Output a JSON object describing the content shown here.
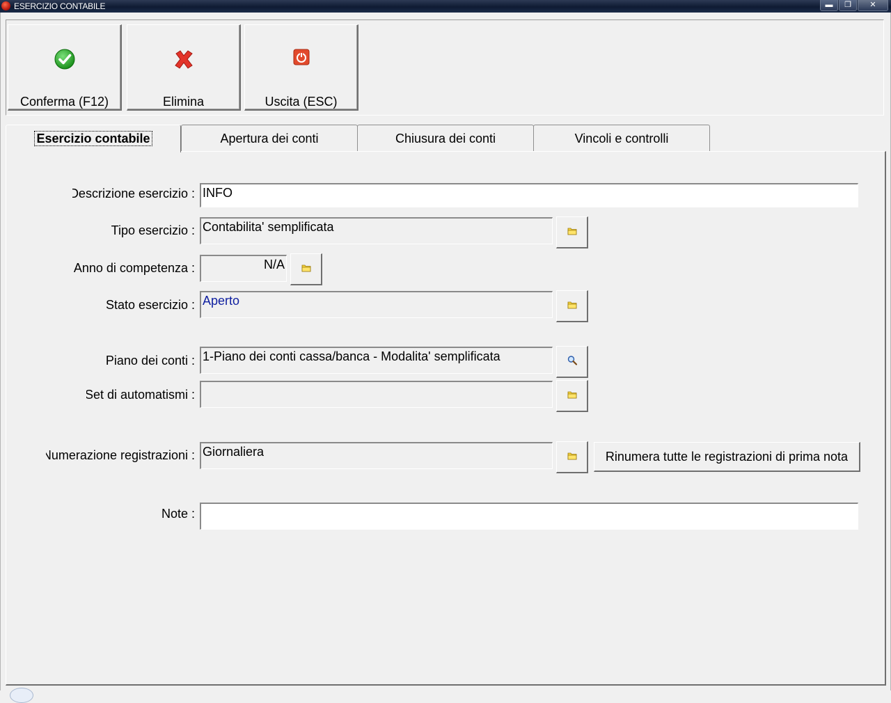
{
  "window": {
    "title": "ESERCIZIO CONTABILE"
  },
  "window_controls": {
    "minimize": "▬",
    "restore": "❐",
    "close": "✕"
  },
  "toolbar": {
    "confirm_label": "Conferma (F12)",
    "delete_label": "Elimina",
    "exit_label": "Uscita (ESC)"
  },
  "tabs": [
    {
      "label": "Esercizio contabile"
    },
    {
      "label": "Apertura dei conti"
    },
    {
      "label": "Chiusura dei conti"
    },
    {
      "label": "Vincoli e controlli"
    }
  ],
  "form": {
    "descrizione": {
      "label": "Descrizione esercizio :",
      "value": "INFO"
    },
    "tipo": {
      "label": "Tipo esercizio :",
      "value": "Contabilita' semplificata"
    },
    "anno": {
      "label": "Anno di competenza :",
      "value": "N/A"
    },
    "stato": {
      "label": "Stato esercizio :",
      "value": "Aperto"
    },
    "piano": {
      "label": "Piano dei conti :",
      "value": "1-Piano dei conti cassa/banca - Modalita' semplificata"
    },
    "automatismi": {
      "label": "Set di automatismi :",
      "value": ""
    },
    "numerazione": {
      "label": "Numerazione registrazioni :",
      "value": "Giornaliera"
    },
    "rinumera_label": "Rinumera tutte le registrazioni di prima nota",
    "note": {
      "label": "Note :",
      "value": ""
    }
  },
  "icons": {
    "confirm": "check-icon",
    "delete": "cross-icon",
    "exit": "power-icon",
    "lookup": "folder-icon",
    "search": "magnifier-icon"
  },
  "colors": {
    "value_blue": "#1020a0",
    "titlebar": "#0f1b33"
  }
}
